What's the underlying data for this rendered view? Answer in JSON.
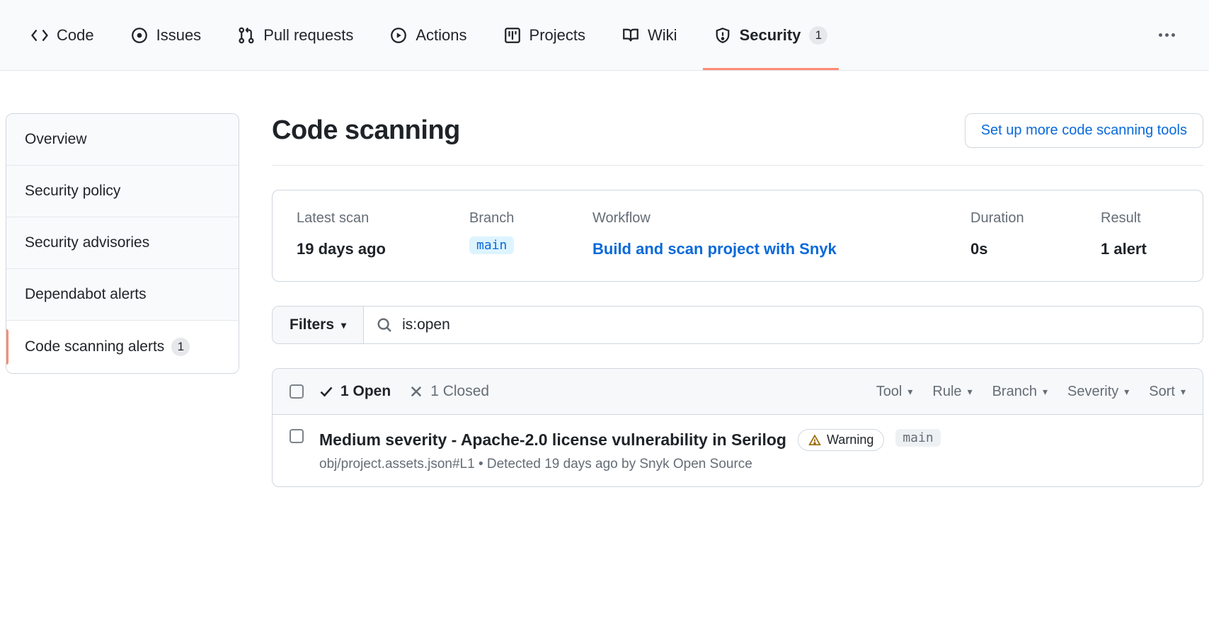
{
  "nav": {
    "code": "Code",
    "issues": "Issues",
    "pull_requests": "Pull requests",
    "actions": "Actions",
    "projects": "Projects",
    "wiki": "Wiki",
    "security": "Security",
    "security_count": "1"
  },
  "sidebar": {
    "overview": "Overview",
    "security_policy": "Security policy",
    "security_advisories": "Security advisories",
    "dependabot_alerts": "Dependabot alerts",
    "code_scanning_alerts": "Code scanning alerts",
    "code_scanning_count": "1"
  },
  "page": {
    "title": "Code scanning",
    "setup_button": "Set up more code scanning tools"
  },
  "summary": {
    "latest_scan_label": "Latest scan",
    "latest_scan_value": "19 days ago",
    "branch_label": "Branch",
    "branch_value": "main",
    "workflow_label": "Workflow",
    "workflow_value": "Build and scan project with Snyk",
    "duration_label": "Duration",
    "duration_value": "0s",
    "result_label": "Result",
    "result_value": "1 alert"
  },
  "filters": {
    "button_label": "Filters",
    "search_value": "is:open"
  },
  "alerts_header": {
    "open_label": "1 Open",
    "closed_label": "1 Closed",
    "tool": "Tool",
    "rule": "Rule",
    "branch": "Branch",
    "severity": "Severity",
    "sort": "Sort"
  },
  "alert": {
    "title": "Medium severity - Apache-2.0 license vulnerability in Serilog",
    "warning_label": "Warning",
    "branch": "main",
    "subtitle": "obj/project.assets.json#L1 • Detected 19 days ago by Snyk Open Source"
  }
}
